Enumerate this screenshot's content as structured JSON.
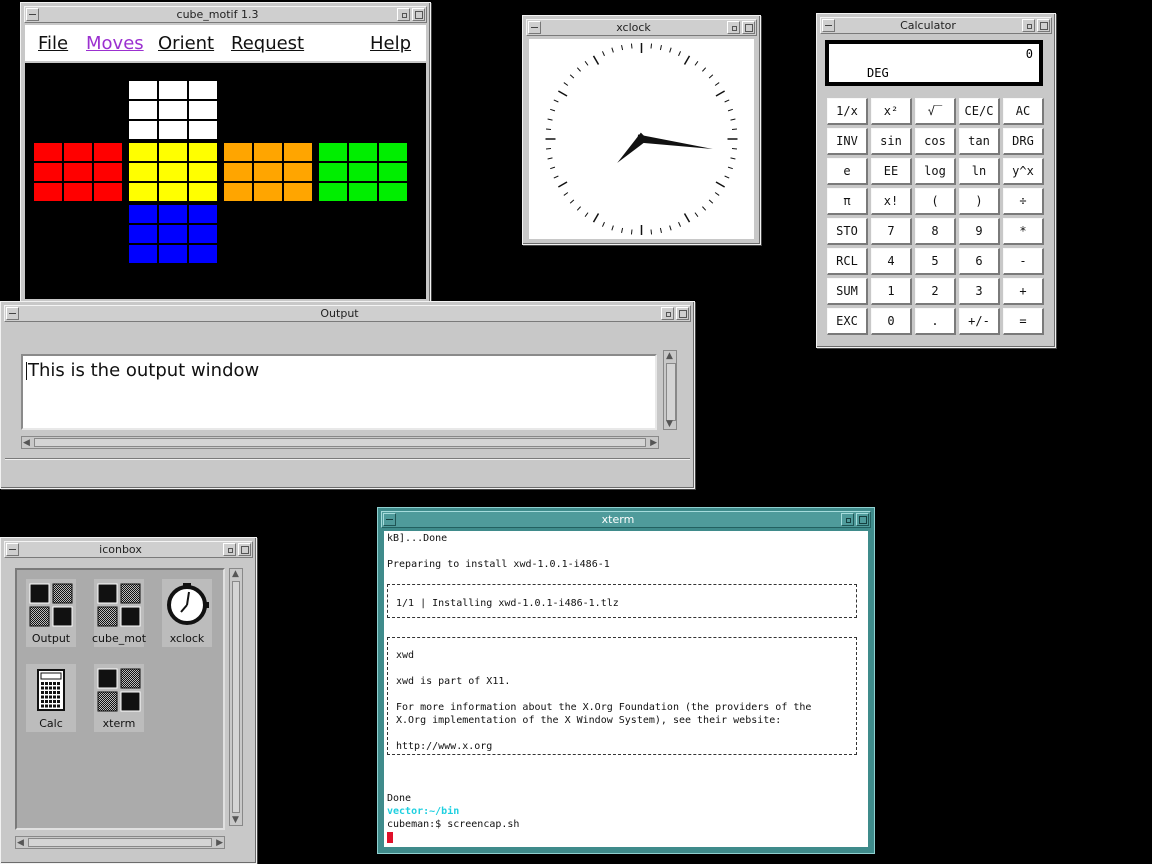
{
  "cube_window": {
    "title": "cube_motif 1.3",
    "menu": [
      "File",
      "Moves",
      "Orient",
      "Request",
      "Help"
    ],
    "faces": [
      {
        "name": "up",
        "color": "#ffffff"
      },
      {
        "name": "left",
        "color": "#ff0000"
      },
      {
        "name": "front",
        "color": "#ffff00"
      },
      {
        "name": "right",
        "color": "#ffa500"
      },
      {
        "name": "back",
        "color": "#00ee00"
      },
      {
        "name": "down",
        "color": "#0000ff"
      }
    ],
    "highlight_color": "#9b30d0"
  },
  "clock_window": {
    "title": "xclock",
    "time": {
      "hour": 2,
      "minute": 15
    }
  },
  "calculator_window": {
    "title": "Calculator",
    "display_value": "0",
    "display_mode": "DEG",
    "keys": [
      "1/x",
      "x²",
      "√‾",
      "CE/C",
      "AC",
      "INV",
      "sin",
      "cos",
      "tan",
      "DRG",
      "e",
      "EE",
      "log",
      "ln",
      "y^x",
      "π",
      "x!",
      "(",
      ")",
      "÷",
      "STO",
      "7",
      "8",
      "9",
      "*",
      "RCL",
      "4",
      "5",
      "6",
      "-",
      "SUM",
      "1",
      "2",
      "3",
      "+",
      "EXC",
      "0",
      ".",
      "+/-",
      "="
    ]
  },
  "output_window": {
    "title": "Output",
    "text": "This is the output window"
  },
  "iconbox_window": {
    "title": "iconbox",
    "icons": [
      {
        "label": "Output",
        "icon": "motif-window-icon"
      },
      {
        "label": "cube_mot",
        "icon": "motif-window-icon"
      },
      {
        "label": "xclock",
        "icon": "clock-icon"
      },
      {
        "label": "Calc",
        "icon": "calculator-icon"
      },
      {
        "label": "xterm",
        "icon": "motif-window-icon"
      }
    ]
  },
  "xterm_window": {
    "title": "xterm",
    "lines": {
      "l1": "kB]...Done",
      "l2": "Preparing to install xwd-1.0.1-i486-1",
      "l3": "1/1 | Installing xwd-1.0.1-i486-1.tlz",
      "l4": "xwd",
      "l5": "xwd is part of X11.",
      "l6": "For more information about the X.Org Foundation (the providers of the",
      "l7": "X.Org implementation of the X Window System), see their website:",
      "l8": "http://www.x.org",
      "l9": "Done",
      "prompt1": "vector:~/bin",
      "prompt2": "cubeman:$ screencap.sh"
    },
    "frame_color": "#3f8b8b",
    "prompt_color": "#1fd0e0",
    "cursor_color": "#e0102a"
  }
}
